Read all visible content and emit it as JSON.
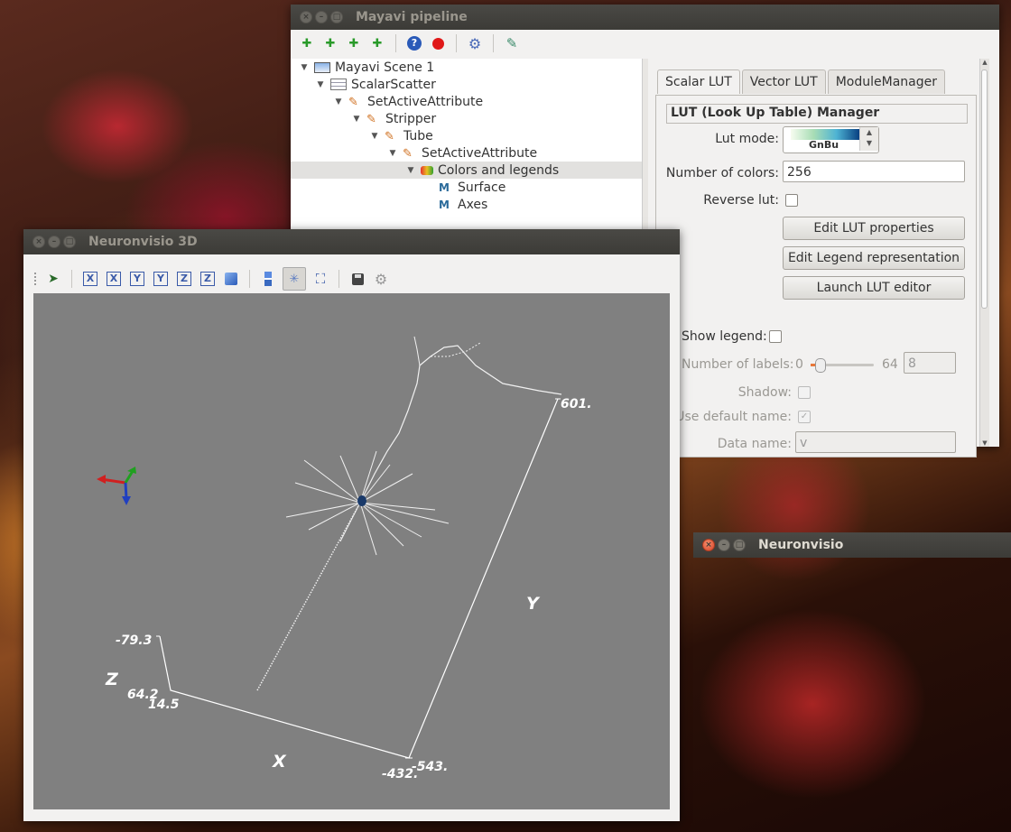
{
  "pipeline_window": {
    "title": "Mayavi pipeline",
    "tree": [
      {
        "label": "Mayavi Scene 1",
        "icon": "scene-icon"
      },
      {
        "label": "ScalarScatter",
        "icon": "table-icon"
      },
      {
        "label": "SetActiveAttribute",
        "icon": "filter-icon"
      },
      {
        "label": "Stripper",
        "icon": "filter-icon"
      },
      {
        "label": "Tube",
        "icon": "filter-icon"
      },
      {
        "label": "SetActiveAttribute",
        "icon": "filter-icon"
      },
      {
        "label": "Colors and legends",
        "icon": "colors-icon"
      },
      {
        "label": "Surface",
        "icon": "module-icon"
      },
      {
        "label": "Axes",
        "icon": "module-icon"
      }
    ],
    "tabs": [
      "Scalar LUT",
      "Vector LUT",
      "ModuleManager"
    ],
    "section_title": "LUT (Look Up Table) Manager",
    "lut_mode_label": "Lut mode:",
    "lut_mode_value": "GnBu",
    "num_colors_label": "Number of colors:",
    "num_colors_value": "256",
    "reverse_lut_label": "Reverse lut:",
    "edit_lut_props": "Edit LUT properties",
    "edit_legend": "Edit Legend representation",
    "launch_lut_editor": "Launch LUT editor",
    "show_legend_label": "Show legend:",
    "num_labels_label": "Number of labels:",
    "num_labels_min": "0",
    "num_labels_max": "64",
    "num_labels_value": "8",
    "shadow_label": "Shadow:",
    "use_default_name_label": "Use default name:",
    "data_name_label": "Data name:",
    "data_name_value": "v"
  },
  "viewer_window": {
    "title": "Neuronvisio 3D",
    "axis_labels": {
      "x": "X",
      "y": "Y",
      "z": "Z",
      "y_max": "601.",
      "z_top": "-79.3",
      "z_mid": "64.2",
      "x_near": "14.5",
      "x_a": "-432.",
      "x_b": "-543."
    }
  },
  "small_window": {
    "title": "Neuronvisio"
  },
  "colors": {
    "titlebar": "#3c3b37",
    "viewport_bg": "#808080",
    "lut_gradient_start": "#f7fcf0",
    "lut_gradient_end": "#084081"
  }
}
